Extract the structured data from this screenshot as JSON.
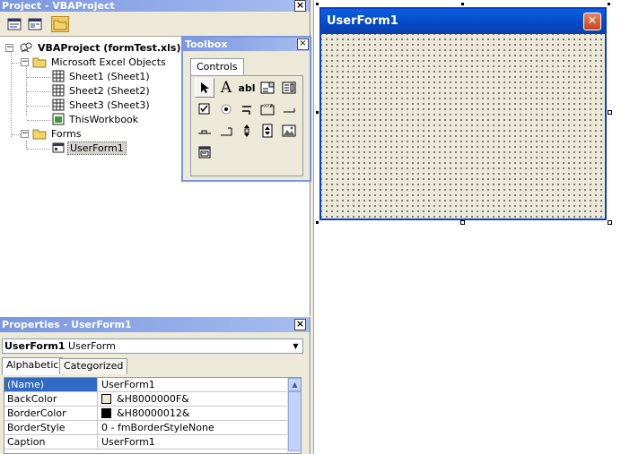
{
  "project": {
    "title": "Project - VBAProject",
    "close": "×",
    "tree": {
      "root": "VBAProject (formTest.xls)",
      "excel_objects": "Microsoft Excel Objects",
      "sheets": [
        "Sheet1 (Sheet1)",
        "Sheet2 (Sheet2)",
        "Sheet3 (Sheet3)"
      ],
      "workbook": "ThisWorkbook",
      "forms": "Forms",
      "form_item": "UserForm1"
    }
  },
  "toolbox": {
    "title": "Toolbox",
    "close": "×",
    "tab": "Controls",
    "tools": [
      {
        "name": "select-objects-icon",
        "glyph": "➤"
      },
      {
        "name": "label-icon",
        "glyph": "A"
      },
      {
        "name": "textbox-icon",
        "glyph": "abl"
      },
      {
        "name": "combobox-icon",
        "glyph": "▤"
      },
      {
        "name": "listbox-icon",
        "glyph": "▦"
      },
      {
        "name": "checkbox-icon",
        "glyph": "☑"
      },
      {
        "name": "optionbutton-icon",
        "glyph": "◉"
      },
      {
        "name": "togglebutton-icon",
        "glyph": "⫧"
      },
      {
        "name": "frame-icon",
        "glyph": "⬚"
      },
      {
        "name": "commandbutton-icon",
        "glyph": "▭"
      },
      {
        "name": "tabstrip-icon",
        "glyph": "⎽"
      },
      {
        "name": "multipage-icon",
        "glyph": "⎺"
      },
      {
        "name": "scrollbar-icon",
        "glyph": "⇕"
      },
      {
        "name": "spinbutton-icon",
        "glyph": "⇳"
      },
      {
        "name": "image-icon",
        "glyph": "▧"
      },
      {
        "name": "refedit-icon",
        "glyph": "▣"
      }
    ]
  },
  "userform": {
    "title": "UserForm1",
    "close": "✕"
  },
  "properties": {
    "title": "Properties - UserForm1",
    "close": "×",
    "object_name": "UserForm1",
    "object_type": "UserForm",
    "tabs": [
      "Alphabetic",
      "Categorized"
    ],
    "rows": [
      {
        "name": "(Name)",
        "value": "UserForm1",
        "swatch": ""
      },
      {
        "name": "BackColor",
        "value": "&H8000000F&",
        "swatch": "#ece9d8"
      },
      {
        "name": "BorderColor",
        "value": "&H80000012&",
        "swatch": "#000000"
      },
      {
        "name": "BorderStyle",
        "value": "0 - fmBorderStyleNone",
        "swatch": ""
      },
      {
        "name": "Caption",
        "value": "UserForm1",
        "swatch": ""
      }
    ]
  },
  "colors": {
    "selection": "#316ac5",
    "xp_titlebar": "#0a5fe0",
    "face": "#ece9d8"
  }
}
